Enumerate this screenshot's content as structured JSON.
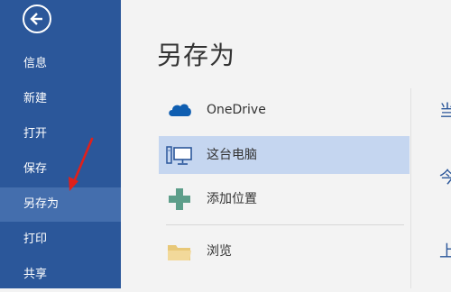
{
  "sidebar": {
    "items": [
      {
        "label": "信息"
      },
      {
        "label": "新建"
      },
      {
        "label": "打开"
      },
      {
        "label": "保存"
      },
      {
        "label": "另存为"
      },
      {
        "label": "打印"
      },
      {
        "label": "共享"
      }
    ],
    "active_index": 4,
    "back_icon": "back-arrow-icon"
  },
  "main": {
    "title": "另存为",
    "locations": [
      {
        "label": "OneDrive",
        "icon": "onedrive-cloud-icon"
      },
      {
        "label": "这台电脑",
        "icon": "computer-icon"
      },
      {
        "label": "添加位置",
        "icon": "plus-icon"
      },
      {
        "label": "浏览",
        "icon": "folder-icon"
      }
    ],
    "right_partial": [
      "当",
      "今",
      "上"
    ]
  },
  "colors": {
    "sidebar": "#2b579a",
    "sidebar_active": "#446ead",
    "selected": "#c5d6f0",
    "annotation": "#e0201b"
  }
}
